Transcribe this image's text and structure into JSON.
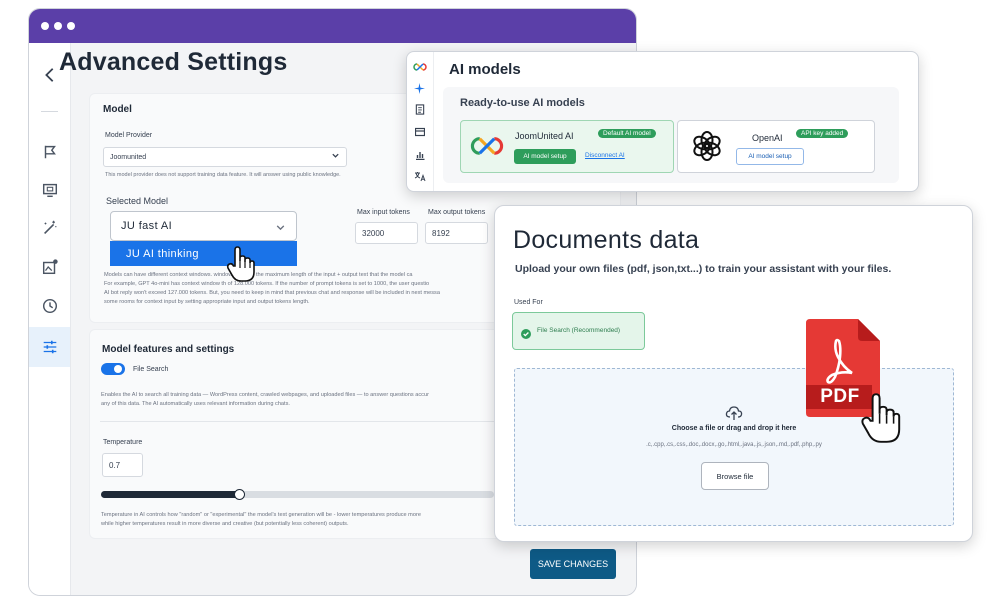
{
  "settings": {
    "title": "Advanced Settings",
    "model_section": {
      "heading": "Model",
      "provider_label": "Model Provider",
      "provider_value": "Joomunited",
      "provider_note": "This model provider does not support training data feature. It will answer using public knowledge.",
      "selected_model_label": "Selected Model",
      "selected_model_value": "JU fast AI",
      "dropdown_option": "JU AI thinking",
      "max_input_label": "Max input tokens",
      "max_input_value": "32000",
      "max_output_label": "Max output tokens",
      "max_output_value": "8192",
      "help_line1": "Models can have different context windows. window refers to the maximum length of the input + output text that the model ca",
      "help_line2": "For example, GPT 4o-mini has context window th of 128.000 tokens. If the number of prompt tokens is set to 1000, the user questio",
      "help_line3": "AI bot reply won't exceed 127.000 tokens. But, you need to keep in mind that previous chat and response will be included in next messa",
      "help_line4": "some rooms for context input by setting appropriate input and output tokens length."
    },
    "features_section": {
      "heading": "Model features and settings",
      "toggle_label": "File Search",
      "toggle_on": true,
      "desc_line1": "Enables the AI to search all training data — WordPress content, crawled webpages, and uploaded files — to answer questions accur",
      "desc_line2": "any of this data. The AI automatically uses relevant information during chats.",
      "temperature_label": "Temperature",
      "temperature_value": "0.7",
      "temperature_fraction": 0.35,
      "temp_help_line1": "Temperature in AI controls how \"random\" or \"experimental\" the model's text generation will be - lower temperatures produce more",
      "temp_help_line2": "while higher temperatures result in more diverse and creative (but potentially less coherent) outputs."
    },
    "save_label": "SAVE CHANGES"
  },
  "ai_models": {
    "title": "AI models",
    "subtitle": "Ready-to-use AI models",
    "joom": {
      "name": "JoomUnited AI",
      "badge": "Default AI model",
      "setup_label": "AI model setup",
      "disconnect_label": "Disconnect AI"
    },
    "openai": {
      "name": "OpenAI",
      "badge": "API key added",
      "setup_label": "AI model setup"
    }
  },
  "documents": {
    "title": "Documents data",
    "subtitle": "Upload your own files (pdf, json,txt...) to train your assistant with your files.",
    "used_for_label": "Used For",
    "used_for_value": "File Search (Recommended)",
    "drop_label": "Choose a file or drag and drop it here",
    "extensions": ".c,.cpp,.cs,.css,.doc,.docx,.go,.html,.java,.js,.json,.md,.pdf,.php,.py",
    "browse_label": "Browse file",
    "pdf_label": "PDF"
  },
  "colors": {
    "titlebar": "#5b3fa8",
    "accent_blue": "#1a73e8",
    "green": "#2e9d5b",
    "save_button": "#0e5a86",
    "pdf_red": "#e53935"
  }
}
